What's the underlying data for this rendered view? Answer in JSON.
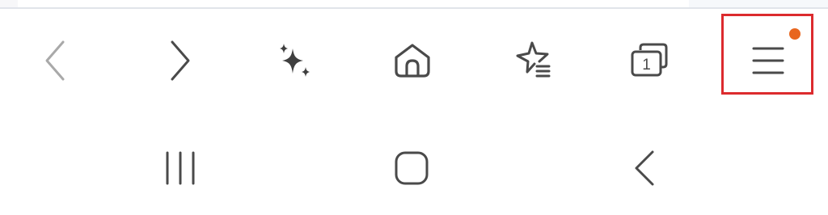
{
  "colors": {
    "icon_active": "#4a4a4a",
    "icon_disabled": "#a9a9a9",
    "highlight_border": "#dc2b2e",
    "notification_dot": "#e8661f"
  },
  "toolbar": {
    "back": {
      "icon": "chevron-left-icon",
      "enabled": false
    },
    "forward": {
      "icon": "chevron-right-icon",
      "enabled": true
    },
    "ai": {
      "icon": "sparkles-icon"
    },
    "home": {
      "icon": "home-icon"
    },
    "bookmarks": {
      "icon": "star-list-icon"
    },
    "tabs": {
      "icon": "tabs-icon",
      "count": "1"
    },
    "menu": {
      "icon": "hamburger-menu-icon",
      "has_notification": true
    }
  },
  "system_nav": {
    "recents": {
      "icon": "recent-apps-icon"
    },
    "home": {
      "icon": "home-square-icon"
    },
    "back": {
      "icon": "back-chevron-icon"
    }
  }
}
